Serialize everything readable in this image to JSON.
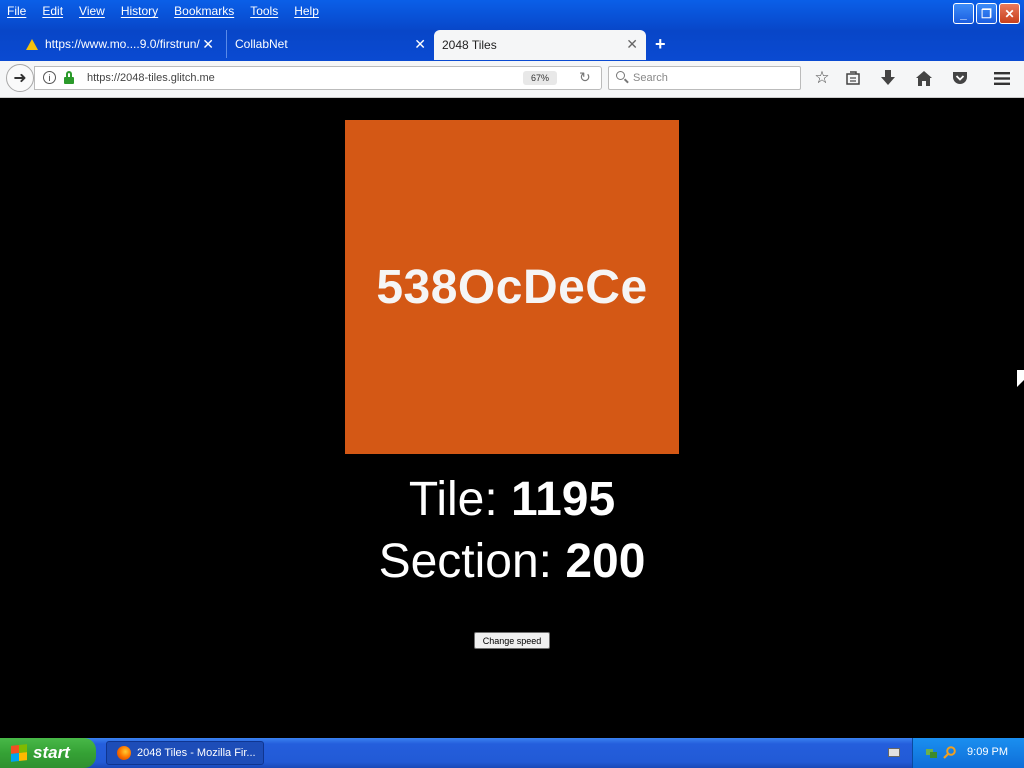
{
  "menu": [
    "File",
    "Edit",
    "View",
    "History",
    "Bookmarks",
    "Tools",
    "Help"
  ],
  "tabs": [
    {
      "label": "https://www.mo....9.0/firstrun/",
      "icon": "warning-icon"
    },
    {
      "label": "CollabNet"
    },
    {
      "label": "2048 Tiles",
      "active": true
    }
  ],
  "nav": {
    "url": "https://2048-tiles.glitch.me",
    "zoom": "67%",
    "search_placeholder": "Search"
  },
  "page": {
    "tile_label": "538OcDeCe",
    "tile_color": "#d45815",
    "tile_prefix": "Tile: ",
    "tile_value": "1195",
    "section_prefix": "Section: ",
    "section_value": "200",
    "button_label": "Change speed"
  },
  "taskbar": {
    "start_label": "start",
    "task_label": "2048 Tiles - Mozilla Fir...",
    "clock": "9:09 PM"
  }
}
